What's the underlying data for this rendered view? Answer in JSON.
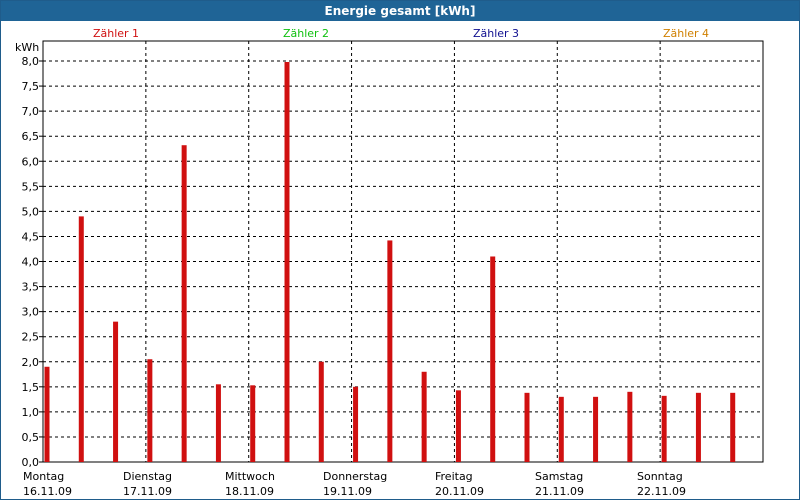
{
  "window": {
    "title": "Energie gesamt [kWh]"
  },
  "chart_data": {
    "type": "bar",
    "title": "Energie gesamt [kWh]",
    "ylabel": "kWh",
    "ylim": [
      0,
      8
    ],
    "yticks": [
      "0,0",
      "0,5",
      "1,0",
      "1,5",
      "2,0",
      "2,5",
      "3,0",
      "3,5",
      "4,0",
      "4,5",
      "5,0",
      "5,5",
      "6,0",
      "6,5",
      "7,0",
      "7,5",
      "8,0"
    ],
    "grid": true,
    "legend_position": "top",
    "legend": [
      {
        "label": "Zähler 1",
        "color": "#d01010"
      },
      {
        "label": "Zähler 2",
        "color": "#10c010"
      },
      {
        "label": "Zähler 3",
        "color": "#101090"
      },
      {
        "label": "Zähler 4",
        "color": "#d08000"
      }
    ],
    "days": [
      {
        "name": "Montag",
        "date": "16.11.09"
      },
      {
        "name": "Dienstag",
        "date": "17.11.09"
      },
      {
        "name": "Mittwoch",
        "date": "18.11.09"
      },
      {
        "name": "Donnerstag",
        "date": "19.11.09"
      },
      {
        "name": "Freitag",
        "date": "20.11.09"
      },
      {
        "name": "Samstag",
        "date": "21.11.09"
      },
      {
        "name": "Sonntag",
        "date": "22.11.09"
      }
    ],
    "series": [
      {
        "name": "Zähler 1",
        "color": "#d01010",
        "values": [
          1.9,
          4.9,
          2.8,
          2.05,
          6.32,
          1.55,
          1.53,
          7.98,
          2.0,
          1.5,
          4.42,
          1.8,
          1.43,
          4.1,
          1.38,
          1.3,
          1.3,
          1.4,
          1.32,
          1.38,
          1.38
        ]
      }
    ]
  }
}
